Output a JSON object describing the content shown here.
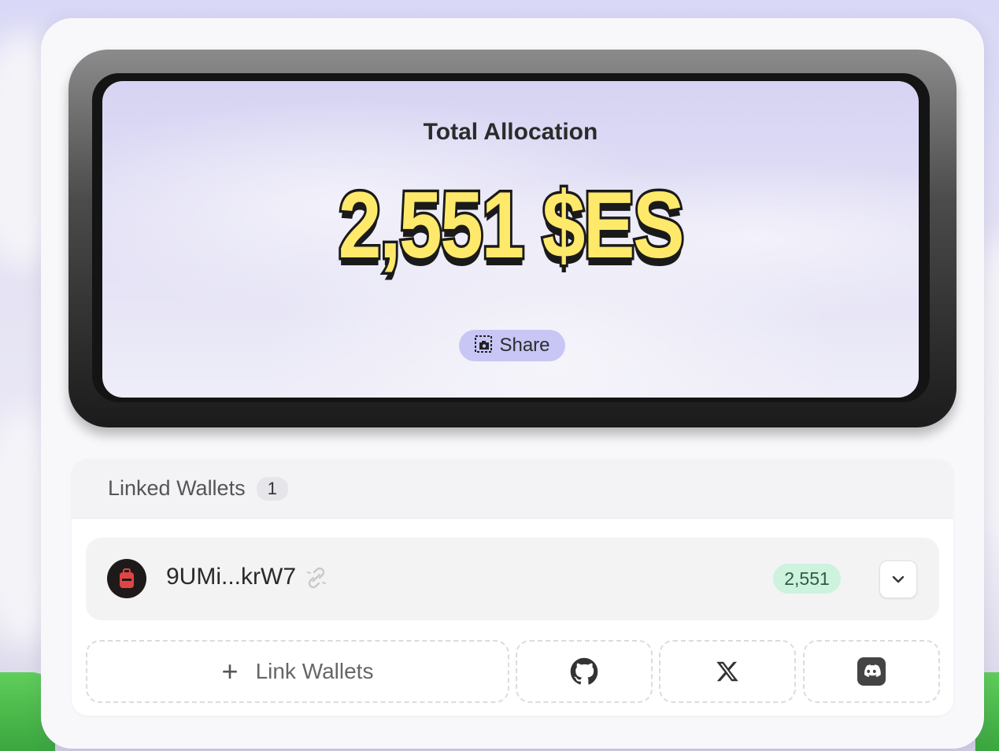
{
  "allocation": {
    "title": "Total Allocation",
    "amount": "2,551 $ES",
    "share_label": "Share"
  },
  "linked_wallets": {
    "title": "Linked Wallets",
    "count": "1",
    "wallets": [
      {
        "address": "9UMi...krW7",
        "amount": "2,551"
      }
    ],
    "link_label": "Link Wallets"
  },
  "social": [
    "github-icon",
    "x-icon",
    "discord-icon"
  ],
  "colors": {
    "amount_fill": "#ffe96b",
    "share_bg": "#c8c6f5",
    "amount_badge_bg": "#cdf2dd"
  }
}
